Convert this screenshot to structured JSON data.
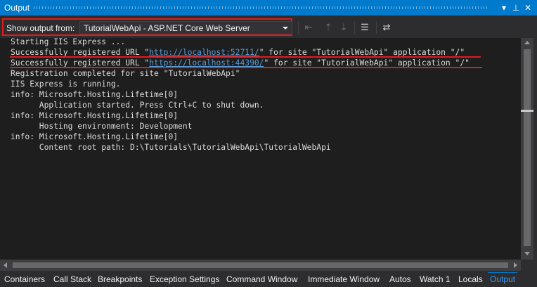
{
  "window": {
    "title": "Output",
    "controls": {
      "dropdown": "▾",
      "pin": "⊥",
      "close": "✕"
    }
  },
  "toolbar": {
    "show_output_label": "Show output from:",
    "source_value": "TutorialWebApi - ASP.NET Core Web Server",
    "buttons": [
      "goto-prev-message-icon",
      "goto-next-message-icon",
      "find-message-icon",
      "clear-all-icon",
      "toggle-word-wrap-icon"
    ]
  },
  "output": {
    "lines": [
      {
        "text": "Starting IIS Express ..."
      },
      {
        "pre": "Successfully registered URL \"",
        "link": "http://localhost:52711/",
        "post": "\" for site \"TutorialWebApi\" application \"/\""
      },
      {
        "pre": "Successfully registered URL \"",
        "link": "https://localhost:44390/",
        "post": "\" for site \"TutorialWebApi\" application \"/\""
      },
      {
        "text": "Registration completed for site \"TutorialWebApi\""
      },
      {
        "text": "IIS Express is running."
      },
      {
        "text": "info: Microsoft.Hosting.Lifetime[0]"
      },
      {
        "text": "      Application started. Press Ctrl+C to shut down."
      },
      {
        "text": "info: Microsoft.Hosting.Lifetime[0]"
      },
      {
        "text": "      Hosting environment: Development"
      },
      {
        "text": "info: Microsoft.Hosting.Lifetime[0]"
      },
      {
        "text": "      Content root path: D:\\Tutorials\\TutorialWebApi\\TutorialWebApi"
      }
    ]
  },
  "tabs": [
    {
      "label": "Containers"
    },
    {
      "label": "Call Stack"
    },
    {
      "label": "Breakpoints"
    },
    {
      "label": "Exception Settings"
    },
    {
      "label": "Command Window"
    },
    {
      "label": "Immediate Window"
    },
    {
      "label": "Autos"
    },
    {
      "label": "Watch 1"
    },
    {
      "label": "Locals"
    },
    {
      "label": "Output",
      "active": true
    }
  ],
  "colors": {
    "accent": "#007acc",
    "highlight": "#e01b1b",
    "link": "#569cd6",
    "text": "#dcdcdc"
  }
}
